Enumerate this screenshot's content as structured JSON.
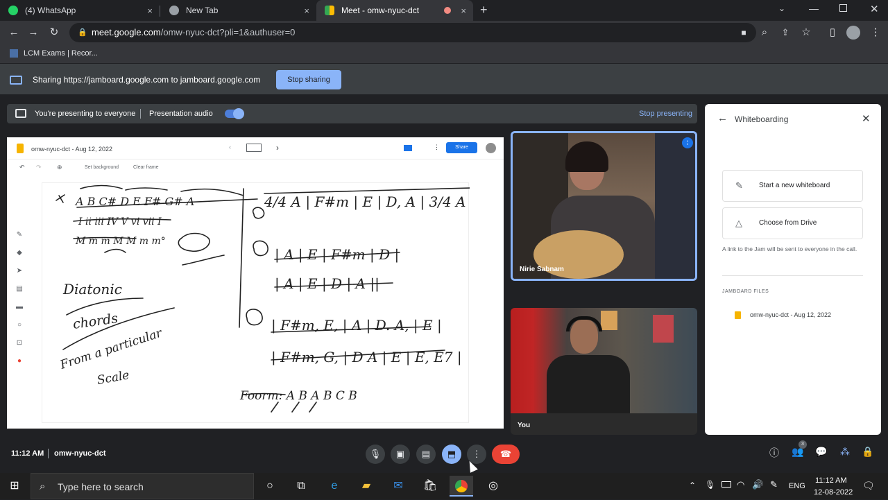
{
  "browser": {
    "tabs": [
      {
        "title": "(4) WhatsApp",
        "close": "×"
      },
      {
        "title": "New Tab",
        "close": "×"
      },
      {
        "title": "Meet - omw-nyuc-dct",
        "close": "×"
      }
    ],
    "new_tab_symbol": "+",
    "url_host": "meet.google.com",
    "url_path": "/omw-nyuc-dct?pli=1&authuser=0",
    "bookmark": "LCM Exams | Recor..."
  },
  "sharing": {
    "message": "Sharing https://jamboard.google.com to jamboard.google.com",
    "stop_label": "Stop sharing"
  },
  "meet": {
    "presenting_text": "You're presenting to everyone",
    "presentation_audio": "Presentation audio",
    "stop_presenting": "Stop presenting",
    "time": "11:12 AM",
    "meeting_code": "omw-nyuc-dct",
    "participants_count": "3",
    "participants": [
      {
        "name": "Nirie Sabnam"
      },
      {
        "name": "You"
      }
    ]
  },
  "jamboard": {
    "title": "omw-nyuc-dct - Aug 12, 2022",
    "share_label": "Share",
    "set_background": "Set background",
    "clear_frame": "Clear frame",
    "handwriting": [
      "Diatonic",
      "chords",
      "From a particular",
      "Scale",
      "Foorm: A   B A  B C B"
    ]
  },
  "panel": {
    "title": "Whiteboarding",
    "start_new": "Start a new whiteboard",
    "choose_drive": "Choose from Drive",
    "info": "A link to the Jam will be sent to everyone in the call.",
    "files_heading": "JAMBOARD FILES",
    "file_name": "omw-nyuc-dct - Aug 12, 2022"
  },
  "taskbar": {
    "search_placeholder": "Type here to search",
    "language": "ENG",
    "clock_time": "11:12 AM",
    "clock_date": "12-08-2022"
  },
  "colors": {
    "accent": "#8ab4f8",
    "hangup": "#ea4335",
    "jam_orange": "#f6b400",
    "share_blue": "#1a73e8"
  }
}
